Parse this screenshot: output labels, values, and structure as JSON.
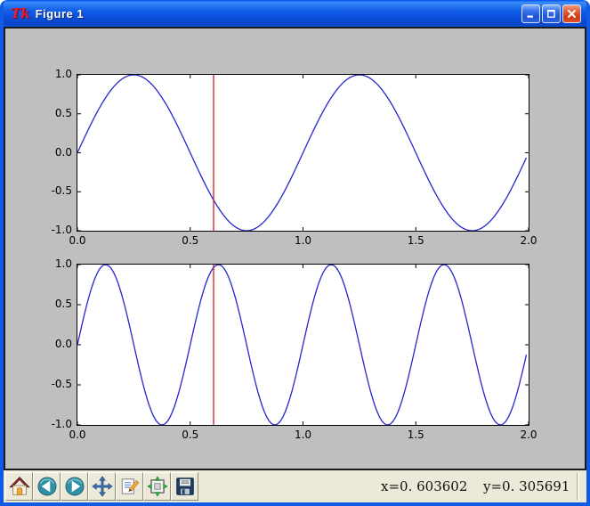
{
  "window": {
    "title": "Figure 1",
    "icon": "tk-logo",
    "controls": [
      {
        "name": "minimize"
      },
      {
        "name": "maximize"
      },
      {
        "name": "close"
      }
    ]
  },
  "colors": {
    "titlebar_blue": "#1460e8",
    "window_border": "#0f5be6",
    "figure_background": "#bfbfbf",
    "axes_background": "#ffffff",
    "toolbar_background": "#ece9d8",
    "curve_blue": "#2525cf",
    "cursor_red": "#cf1f1f",
    "close_button_red": "#ce3a11"
  },
  "toolbar": {
    "buttons": [
      {
        "name": "home",
        "icon": "home-icon"
      },
      {
        "name": "back",
        "icon": "back-icon"
      },
      {
        "name": "forward",
        "icon": "forward-icon"
      },
      {
        "name": "pan",
        "icon": "pan-icon"
      },
      {
        "name": "zoom-to-rect",
        "icon": "zoom-rect-icon"
      },
      {
        "name": "configure-subplots",
        "icon": "subplots-icon"
      },
      {
        "name": "save",
        "icon": "save-icon"
      }
    ],
    "status_x": "x=0. 603602",
    "status_y": "y=0. 305691",
    "cursor_x_value": 0.603602,
    "cursor_y_value": 0.305691
  },
  "chart_data": [
    {
      "type": "line",
      "subplot": "top",
      "title": "",
      "xlabel": "",
      "ylabel": "",
      "xlim": [
        0,
        2
      ],
      "ylim": [
        -1,
        1
      ],
      "grid": false,
      "legend": null,
      "x_ticks": [
        "0.0",
        "0.5",
        "1.0",
        "1.5",
        "2.0"
      ],
      "x_tick_values": [
        0,
        0.5,
        1,
        1.5,
        2
      ],
      "y_ticks": [
        "1.0",
        "0.5",
        "0.0",
        "-0.5",
        "-1.0"
      ],
      "y_tick_values": [
        1,
        0.5,
        0,
        -0.5,
        -1
      ],
      "series": [
        {
          "name": "sin(2*pi*x)",
          "color": "#2525cf",
          "x_start": 0,
          "x_end": 1.99,
          "x_step": 0.01,
          "amplitude": 1,
          "frequency_cycles_per_x_unit": 1,
          "phase": 0
        }
      ],
      "vline": {
        "x": 0.603602,
        "color": "#cf1f1f"
      }
    },
    {
      "type": "line",
      "subplot": "bottom",
      "title": "",
      "xlabel": "",
      "ylabel": "",
      "xlim": [
        0,
        2
      ],
      "ylim": [
        -1,
        1
      ],
      "grid": false,
      "legend": null,
      "x_ticks": [
        "0.0",
        "0.5",
        "1.0",
        "1.5",
        "2.0"
      ],
      "x_tick_values": [
        0,
        0.5,
        1,
        1.5,
        2
      ],
      "y_ticks": [
        "1.0",
        "0.5",
        "0.0",
        "-0.5",
        "-1.0"
      ],
      "y_tick_values": [
        1,
        0.5,
        0,
        -0.5,
        -1
      ],
      "series": [
        {
          "name": "sin(4*pi*x)",
          "color": "#2525cf",
          "x_start": 0,
          "x_end": 1.99,
          "x_step": 0.01,
          "amplitude": 1,
          "frequency_cycles_per_x_unit": 2,
          "phase": 0
        }
      ],
      "vline": {
        "x": 0.603602,
        "color": "#cf1f1f"
      }
    }
  ]
}
